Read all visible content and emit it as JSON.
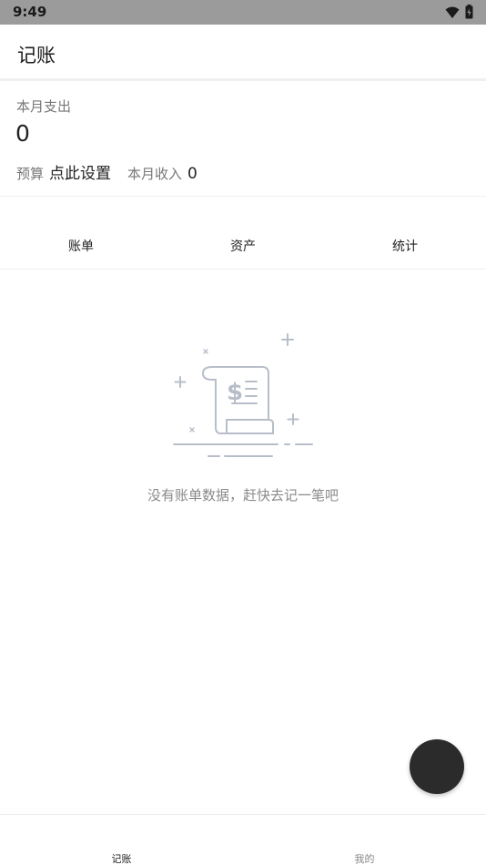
{
  "status_bar": {
    "time": "9:49",
    "icons": [
      "wifi-icon",
      "battery-icon"
    ]
  },
  "app_bar": {
    "title": "记账"
  },
  "summary": {
    "month_expense_label": "本月支出",
    "month_expense_value": "0",
    "budget_label": "预算",
    "budget_action": "点此设置",
    "month_income_label": "本月收入",
    "month_income_value": "0"
  },
  "tabs": [
    {
      "label": "账单"
    },
    {
      "label": "资产"
    },
    {
      "label": "统计"
    }
  ],
  "empty_state": {
    "icon": "receipt-dollar-icon",
    "message": "没有账单数据，赶快去记一笔吧"
  },
  "fab": {
    "icon": "add-icon"
  },
  "bottom_nav": [
    {
      "label": "记账",
      "active": true
    },
    {
      "label": "我的",
      "active": false
    }
  ],
  "colors": {
    "status_bar": "#9b9b9b",
    "fab": "#2b2b2b",
    "muted_text": "#777777",
    "illustration": "#b8bec9"
  }
}
